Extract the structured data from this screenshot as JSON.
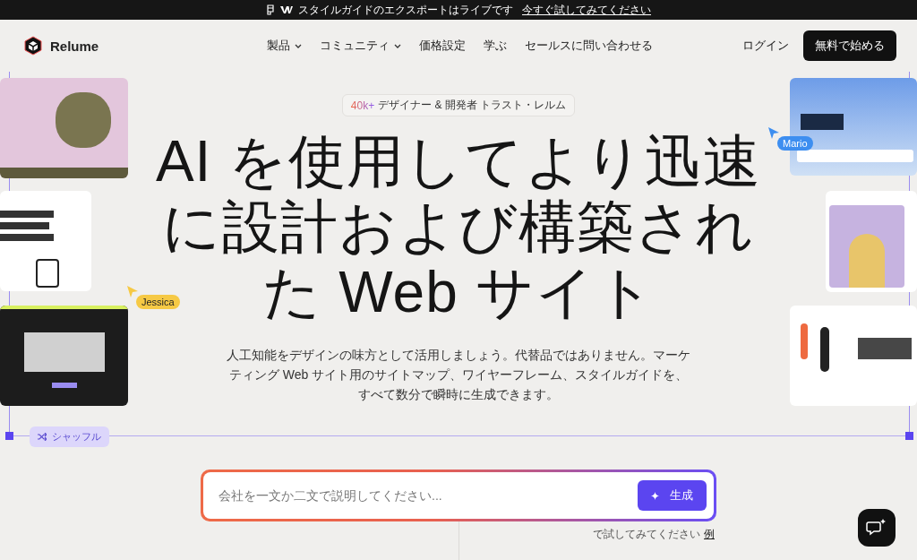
{
  "announcement": {
    "text": "スタイルガイドのエクスポートはライブです",
    "link": "今すぐ試してみてください"
  },
  "nav": {
    "brand": "Relume",
    "items": [
      {
        "label": "製品",
        "dropdown": true
      },
      {
        "label": "コミュニティ",
        "dropdown": true
      },
      {
        "label": "価格設定",
        "dropdown": false
      },
      {
        "label": "学ぶ",
        "dropdown": false
      },
      {
        "label": "セールスに問い合わせる",
        "dropdown": false
      }
    ],
    "login": "ログイン",
    "cta": "無料で始める"
  },
  "hero": {
    "badge_count": "40k+",
    "badge_text": "デザイナー & 開発者 トラスト・レルム",
    "title": [
      "AI を使用してより迅速",
      "に設計および構築され",
      "た Web サイト"
    ],
    "subtitle": "人工知能をデザインの味方として活用しましょう。代替品ではありません。マーケティング Web サイト用のサイトマップ、ワイヤーフレーム、スタイルガイドを、すべて数分で瞬時に生成できます。"
  },
  "cursors": [
    {
      "name": "Mario",
      "color": "#3d8ef0"
    },
    {
      "name": "Jessica",
      "color": "#f6c945"
    }
  ],
  "shuffle": "シャッフル",
  "prompt": {
    "placeholder": "会社を一文か二文で説明してください...",
    "button": "生成"
  },
  "example_hint": {
    "text": "で試してみてください",
    "link": "例"
  }
}
